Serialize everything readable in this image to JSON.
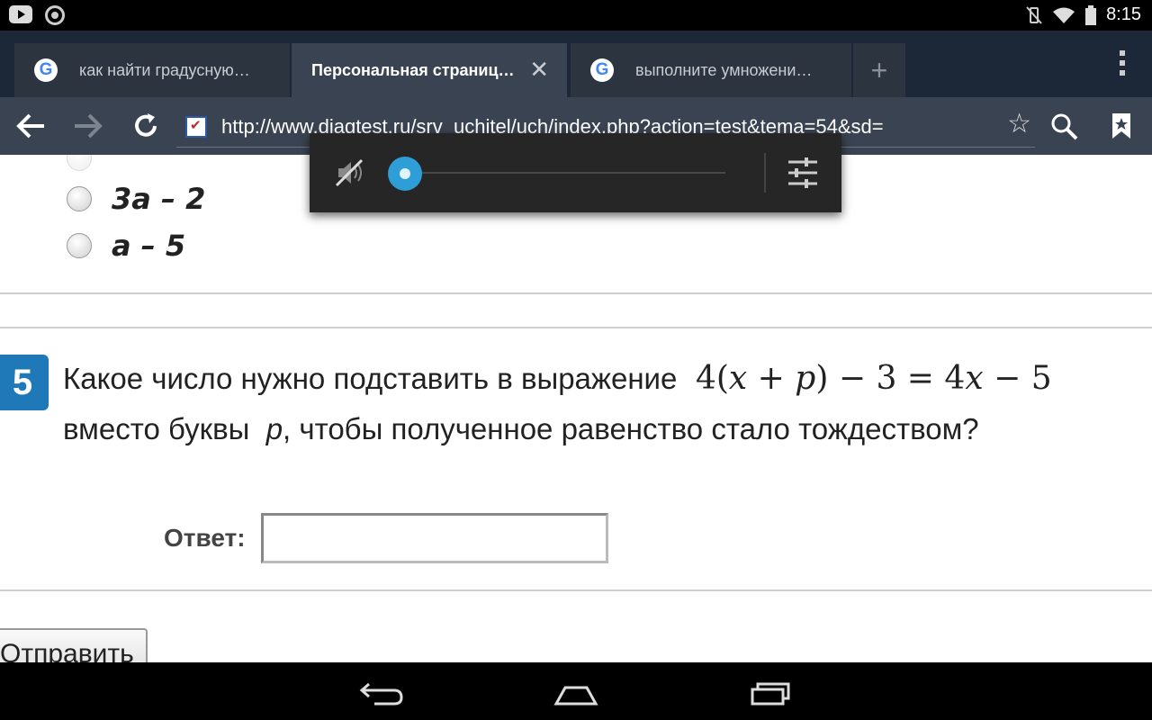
{
  "status_bar": {
    "time": "8:15"
  },
  "tabs": [
    {
      "label": "как найти градусную…",
      "favicon": "G"
    },
    {
      "label": "Персональная страниц…",
      "favicon": "",
      "active": true
    },
    {
      "label": "выполните умножени…",
      "favicon": "G"
    }
  ],
  "toolbar": {
    "url": "http://www.diagtest.ru/srv_uchitel/uch/index.php?action=test&tema=54&sd="
  },
  "page": {
    "options": [
      {
        "text": "3a – 2"
      },
      {
        "text": "a – 5"
      }
    ],
    "question": {
      "number": "5",
      "line1": "Какое число нужно подставить в выражение",
      "math_digits": {
        "a": "4",
        "b": "3",
        "c": "4",
        "d": "5"
      },
      "line2_a": "вместо буквы",
      "line2_var": "p",
      "line2_b": ", чтобы полученное равенство стало тождеством?"
    },
    "answer_label": "Ответ:",
    "submit_label": "Отправить"
  },
  "volume": {
    "level": 0.0
  },
  "colors": {
    "tab_strip": "#1c2738",
    "toolbar": "#3a4351",
    "accent": "#2f9ed6",
    "question_badge": "#1f79b8"
  }
}
